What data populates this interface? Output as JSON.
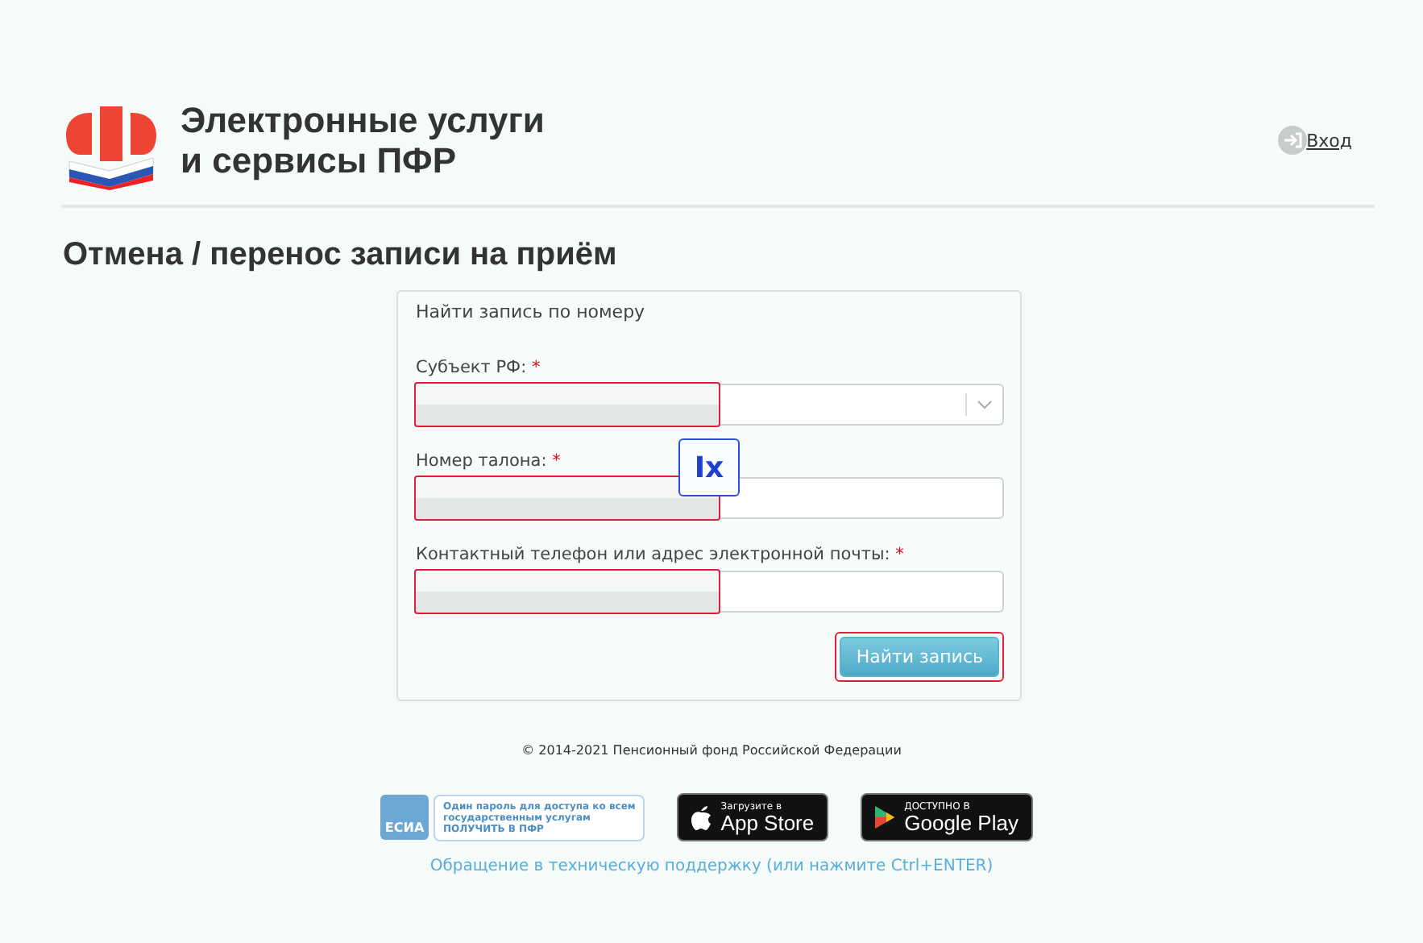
{
  "header": {
    "site_title_line1": "Электронные услуги",
    "site_title_line2": "и сервисы ПФР",
    "login_link": "Вход"
  },
  "page_title": "Отмена / перенос записи на приём",
  "form": {
    "title": "Найти запись по номеру",
    "fields": [
      {
        "kind": "select",
        "label": "Субъект РФ:",
        "required_mark": "*",
        "redacted": true
      },
      {
        "kind": "text",
        "label": "Номер талона:",
        "required_mark": "*",
        "redacted": true
      },
      {
        "kind": "text",
        "label": "Контактный телефон или адрес электронной почты:",
        "required_mark": "*",
        "redacted": true
      }
    ],
    "submit_button": "Найти запись",
    "submit_highlighted": true,
    "annotation_badge": "Ix"
  },
  "footer": {
    "copyright": "© 2014-2021 Пенсионный фонд Российской Федерации",
    "esia": {
      "logo_text": "ЕСИА",
      "line1": "Один пароль для доступа ко всем",
      "line2": "государственным услугам",
      "line3": "ПОЛУЧИТЬ В ПФР"
    },
    "app_store": {
      "small": "Загрузите в",
      "big": "App Store"
    },
    "google_play": {
      "small": "ДОСТУПНО В",
      "big": "Google Play"
    },
    "support_link": "Обращение в техническую поддержку (или нажмите Ctrl+ENTER)"
  }
}
